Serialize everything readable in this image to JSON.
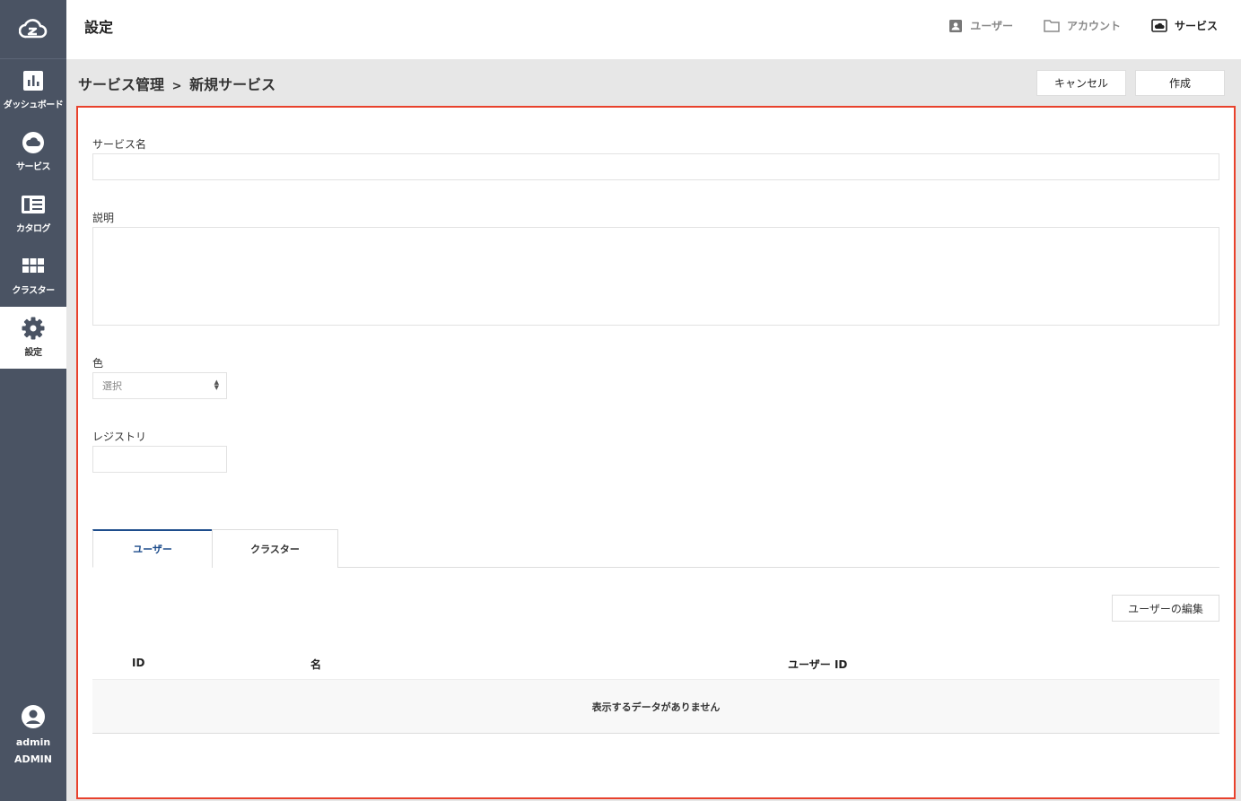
{
  "header": {
    "title": "設定",
    "links": [
      {
        "label": "ユーザー",
        "icon": "user-badge-icon"
      },
      {
        "label": "アカウント",
        "icon": "folder-icon"
      },
      {
        "label": "サービス",
        "icon": "cloud-box-icon"
      }
    ]
  },
  "sidebar": {
    "items": [
      {
        "label": "ダッシュボード",
        "icon": "bar-chart-icon"
      },
      {
        "label": "サービス",
        "icon": "cloud-icon"
      },
      {
        "label": "カタログ",
        "icon": "catalog-icon"
      },
      {
        "label": "クラスター",
        "icon": "grid-icon"
      },
      {
        "label": "設定",
        "icon": "gear-icon"
      }
    ],
    "user": {
      "name": "admin",
      "role": "ADMIN"
    }
  },
  "breadcrumb": {
    "parent": "サービス管理",
    "separator": ">",
    "current": "新規サービス"
  },
  "actions": {
    "cancel": "キャンセル",
    "create": "作成"
  },
  "form": {
    "service_name_label": "サービス名",
    "description_label": "説明",
    "color_label": "色",
    "color_select_value": "選択",
    "registry_label": "レジストリ"
  },
  "tabs": [
    {
      "label": "ユーザー",
      "active": true
    },
    {
      "label": "クラスター",
      "active": false
    }
  ],
  "users_table": {
    "edit_button": "ユーザーの編集",
    "columns": [
      "ID",
      "名",
      "ユーザー ID"
    ],
    "empty_message": "表示するデータがありません"
  },
  "colors": {
    "sidebar": "#4a5363",
    "accent": "#1e4d8c",
    "highlight_border": "#e8412c"
  }
}
